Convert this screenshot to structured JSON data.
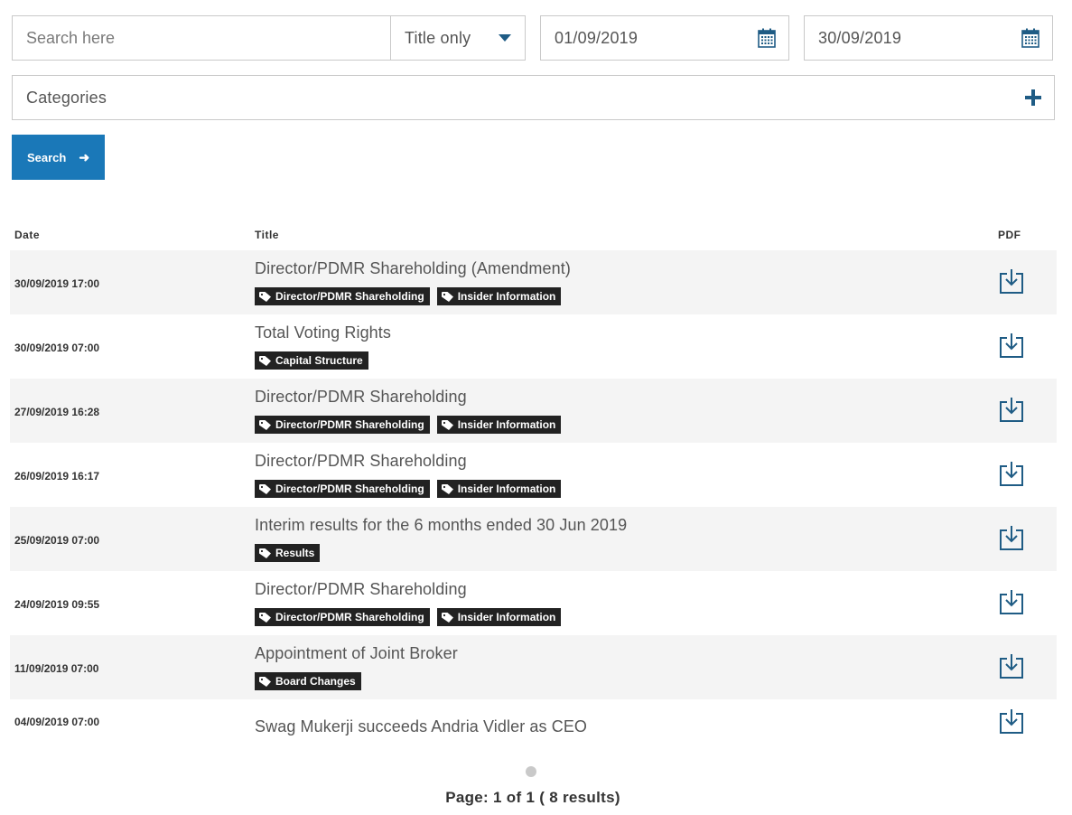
{
  "search": {
    "placeholder": "Search here",
    "value": ""
  },
  "filter": {
    "selected": "Title only"
  },
  "date_from": "01/09/2019",
  "date_to": "30/09/2019",
  "categories_label": "Categories",
  "search_button_label": "Search",
  "columns": {
    "date": "Date",
    "title": "Title",
    "pdf": "PDF"
  },
  "rows": [
    {
      "date": "30/09/2019 17:00",
      "title": "Director/PDMR Shareholding (Amendment)",
      "tags": [
        "Director/PDMR Shareholding",
        "Insider Information"
      ]
    },
    {
      "date": "30/09/2019 07:00",
      "title": "Total Voting Rights",
      "tags": [
        "Capital Structure"
      ]
    },
    {
      "date": "27/09/2019 16:28",
      "title": "Director/PDMR Shareholding",
      "tags": [
        "Director/PDMR Shareholding",
        "Insider Information"
      ]
    },
    {
      "date": "26/09/2019 16:17",
      "title": "Director/PDMR Shareholding",
      "tags": [
        "Director/PDMR Shareholding",
        "Insider Information"
      ]
    },
    {
      "date": "25/09/2019 07:00",
      "title": "Interim results for the 6 months ended 30 Jun 2019",
      "tags": [
        "Results"
      ]
    },
    {
      "date": "24/09/2019 09:55",
      "title": "Director/PDMR Shareholding",
      "tags": [
        "Director/PDMR Shareholding",
        "Insider Information"
      ]
    },
    {
      "date": "11/09/2019 07:00",
      "title": "Appointment of Joint Broker",
      "tags": [
        "Board Changes"
      ]
    },
    {
      "date": "04/09/2019 07:00",
      "title": "Swag Mukerji succeeds Andria Vidler as CEO",
      "tags": []
    }
  ],
  "pagination": {
    "text": "Page: 1 of 1 ( 8 results)"
  },
  "colors": {
    "accent": "#1a78b8",
    "icon": "#1f5c85",
    "tag_bg": "#222222",
    "row_shade": "#f4f4f4"
  }
}
